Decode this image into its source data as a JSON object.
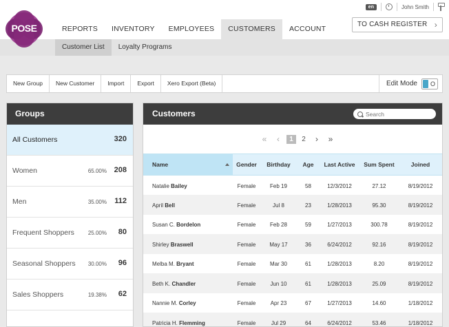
{
  "app": {
    "logo_text": "POSE"
  },
  "top_bar": {
    "language": "en",
    "user": "John Smith"
  },
  "main_nav": [
    {
      "label": "REPORTS",
      "active": false
    },
    {
      "label": "INVENTORY",
      "active": false
    },
    {
      "label": "EMPLOYEES",
      "active": false
    },
    {
      "label": "CUSTOMERS",
      "active": true
    },
    {
      "label": "ACCOUNT",
      "active": false
    }
  ],
  "cash_register_label": "TO CASH REGISTER",
  "sub_nav": [
    {
      "label": "Customer List",
      "active": true
    },
    {
      "label": "Loyalty Programs",
      "active": false
    }
  ],
  "toolbar": {
    "buttons": [
      "New Group",
      "New Customer",
      "Import",
      "Export",
      "Xero Export (Beta)"
    ],
    "edit_mode_label": "Edit Mode",
    "edit_mode_off_glyph": "O"
  },
  "groups": {
    "title": "Groups",
    "items": [
      {
        "name": "All Customers",
        "percent": "",
        "count": "320",
        "active": true
      },
      {
        "name": "Women",
        "percent": "65.00%",
        "count": "208",
        "active": false
      },
      {
        "name": "Men",
        "percent": "35.00%",
        "count": "112",
        "active": false
      },
      {
        "name": "Frequent Shoppers",
        "percent": "25.00%",
        "count": "80",
        "active": false
      },
      {
        "name": "Seasonal Shoppers",
        "percent": "30.00%",
        "count": "96",
        "active": false
      },
      {
        "name": "Sales Shoppers",
        "percent": "19.38%",
        "count": "62",
        "active": false
      }
    ]
  },
  "customers": {
    "title": "Customers",
    "search_placeholder": "Search",
    "pager": {
      "first": "«",
      "prev": "‹",
      "pages": [
        "1",
        "2"
      ],
      "current_page": "1",
      "next": "›",
      "last": "»"
    },
    "columns": [
      "Name",
      "Gender",
      "Birthday",
      "Age",
      "Last Active",
      "Sum Spent",
      "Joined"
    ],
    "rows": [
      {
        "first": "Natalie",
        "last": "Bailey",
        "gender": "Female",
        "birthday": "Feb 19",
        "age": "58",
        "last_active": "12/3/2012",
        "sum_spent": "27.12",
        "joined": "8/19/2012"
      },
      {
        "first": "April",
        "last": "Bell",
        "gender": "Female",
        "birthday": "Jul 8",
        "age": "23",
        "last_active": "1/28/2013",
        "sum_spent": "95.30",
        "joined": "8/19/2012"
      },
      {
        "first": "Susan C.",
        "last": "Bordelon",
        "gender": "Female",
        "birthday": "Feb 28",
        "age": "59",
        "last_active": "1/27/2013",
        "sum_spent": "300.78",
        "joined": "8/19/2012"
      },
      {
        "first": "Shirley",
        "last": "Braswell",
        "gender": "Female",
        "birthday": "May 17",
        "age": "36",
        "last_active": "6/24/2012",
        "sum_spent": "92.16",
        "joined": "8/19/2012"
      },
      {
        "first": "Melba M.",
        "last": "Bryant",
        "gender": "Female",
        "birthday": "Mar 30",
        "age": "61",
        "last_active": "1/28/2013",
        "sum_spent": "8.20",
        "joined": "8/19/2012"
      },
      {
        "first": "Beth K.",
        "last": "Chandler",
        "gender": "Female",
        "birthday": "Jun 10",
        "age": "61",
        "last_active": "1/28/2013",
        "sum_spent": "25.09",
        "joined": "8/19/2012"
      },
      {
        "first": "Nannie M.",
        "last": "Corley",
        "gender": "Female",
        "birthday": "Apr 23",
        "age": "67",
        "last_active": "1/27/2013",
        "sum_spent": "14.60",
        "joined": "1/18/2012"
      },
      {
        "first": "Patricia H.",
        "last": "Flemming",
        "gender": "Female",
        "birthday": "Jul 29",
        "age": "64",
        "last_active": "6/24/2012",
        "sum_spent": "53.46",
        "joined": "1/18/2012"
      }
    ]
  }
}
